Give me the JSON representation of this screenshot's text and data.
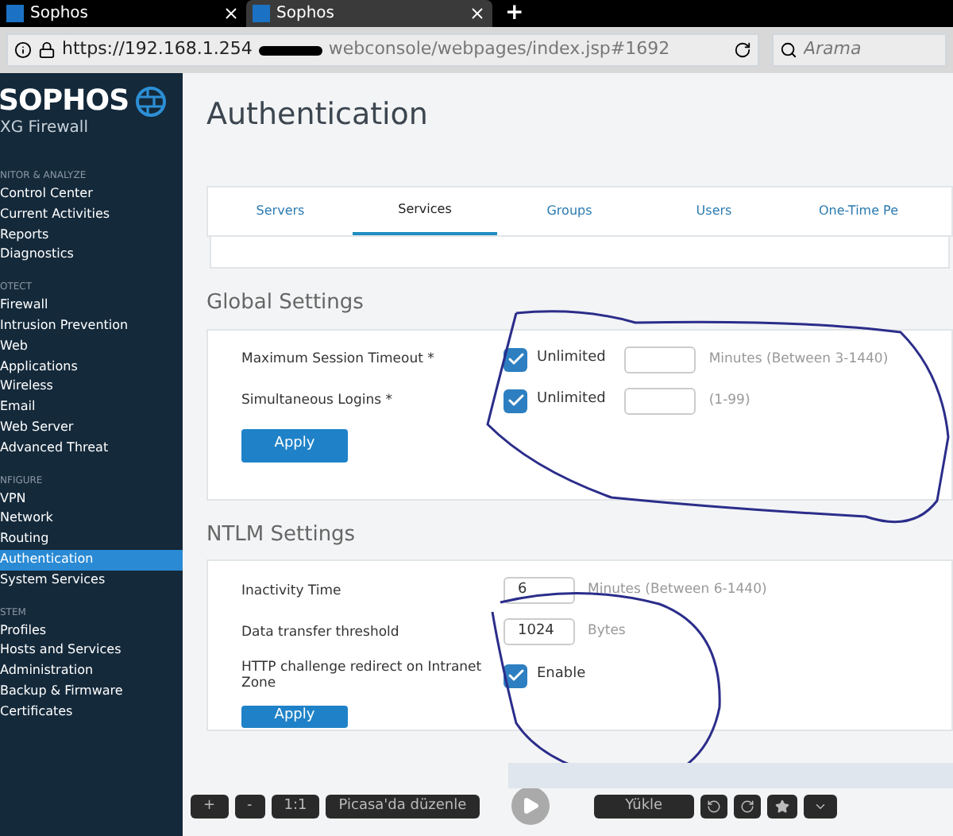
{
  "browser": {
    "tabs": [
      {
        "title": "Sophos",
        "selected": false
      },
      {
        "title": "Sophos",
        "selected": true
      }
    ],
    "new_tab": "+",
    "url": "https://192.168.1.254",
    "url_rest": "webconsole/webpages/index.jsp#1692",
    "search": {
      "placeholder": "Arama"
    }
  },
  "sidebar": {
    "logo": "SOPHOS",
    "product": "XG Firewall",
    "sections": [
      {
        "title": "NITOR & ANALYZE",
        "items": [
          {
            "label": "Control Center",
            "selected": false
          },
          {
            "label": "Current Activities",
            "selected": false
          },
          {
            "label": "Reports",
            "selected": false
          },
          {
            "label": "Diagnostics",
            "selected": false
          }
        ]
      },
      {
        "title": "OTECT",
        "items": [
          {
            "label": "Firewall",
            "selected": false
          },
          {
            "label": "Intrusion Prevention",
            "selected": false
          },
          {
            "label": "Web",
            "selected": false
          },
          {
            "label": "Applications",
            "selected": false
          },
          {
            "label": "Wireless",
            "selected": false
          },
          {
            "label": "Email",
            "selected": false
          },
          {
            "label": "Web Server",
            "selected": false
          },
          {
            "label": "Advanced Threat",
            "selected": false
          }
        ]
      },
      {
        "title": "NFIGURE",
        "items": [
          {
            "label": "VPN",
            "selected": false
          },
          {
            "label": "Network",
            "selected": false
          },
          {
            "label": "Routing",
            "selected": false
          },
          {
            "label": "Authentication",
            "selected": true
          },
          {
            "label": "System Services",
            "selected": false
          }
        ]
      },
      {
        "title": "STEM",
        "items": [
          {
            "label": "Profiles",
            "selected": false
          },
          {
            "label": "Hosts and Services",
            "selected": false
          },
          {
            "label": "Administration",
            "selected": false
          },
          {
            "label": "Backup & Firmware",
            "selected": false
          },
          {
            "label": "Certificates",
            "selected": false
          }
        ]
      }
    ]
  },
  "page_title": "Authentication",
  "tabs": [
    {
      "label": "Servers",
      "selected": false
    },
    {
      "label": "Services",
      "selected": true
    },
    {
      "label": "Groups",
      "selected": false
    },
    {
      "label": "Users",
      "selected": false
    },
    {
      "label": "One-Time Pe",
      "selected": false
    }
  ],
  "sections": [
    {
      "title": "Global Settings",
      "rows": [
        {
          "label": "Maximum Session Timeout *",
          "kind": "check_input",
          "checked": true,
          "check_label": "Unlimited",
          "hint": "Minutes (Between 3-1440)"
        },
        {
          "label": "Simultaneous Logins *",
          "kind": "check_input",
          "checked": true,
          "check_label": "Unlimited",
          "hint": "(1-99)"
        }
      ],
      "button": "Apply"
    },
    {
      "title": "NTLM Settings",
      "rows": [
        {
          "label": "Inactivity Time",
          "kind": "input",
          "value": "6",
          "hint": "Minutes (Between 6-1440)"
        },
        {
          "label": "Data transfer threshold",
          "kind": "input",
          "value": "1024",
          "hint": "Bytes"
        },
        {
          "label": "HTTP challenge redirect on Intranet Zone",
          "kind": "check",
          "checked": true,
          "check_label": "Enable"
        }
      ],
      "button": "Apply"
    }
  ],
  "viewer_toolbar": {
    "buttons": [
      "+",
      "-",
      "1:1",
      "Picasa'da düzenle"
    ],
    "upload": "Yükle"
  }
}
